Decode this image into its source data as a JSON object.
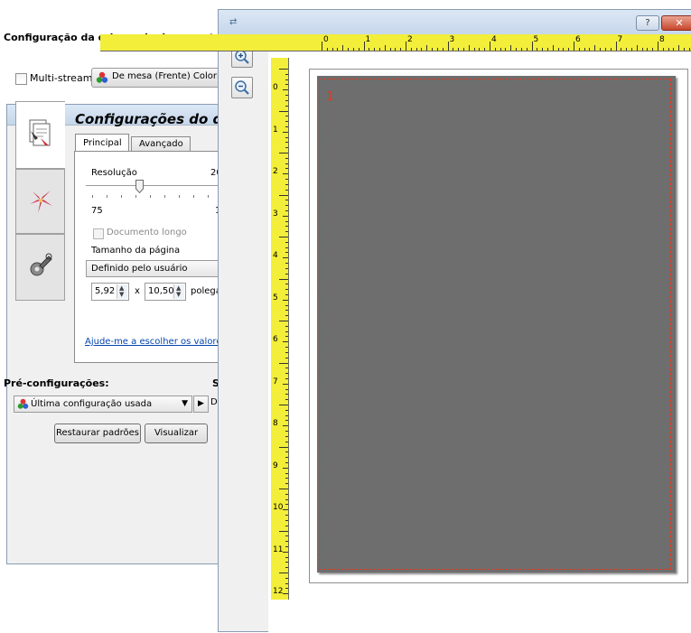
{
  "settings_window": {
    "title": "Configuração da origem do documento",
    "multistream_label": "Multi-stream",
    "multistream_checked": false,
    "source_button_label": "De mesa (Frente) Colori",
    "panel_heading": "Configurações do do",
    "tabs": [
      "Principal",
      "Avançado"
    ],
    "active_tab": "Principal",
    "resolution_label": "Resolução",
    "resolution_value_partial": "200",
    "resolution_min": "75",
    "resolution_max_partial": "1",
    "long_document_label": "Documento longo",
    "long_document_checked": false,
    "page_size_label": "Tamanho da página",
    "page_size_value": "Definido pelo usuário",
    "width_value": "5,92",
    "height_value": "10,50",
    "times_sign": "x",
    "unit_partial": "polega",
    "help_link": "Ajude-me a escolher os valore",
    "presets_label": "Pré-configurações:",
    "s_partial": "S",
    "presets_value": "Última configuração usada",
    "d_partial": "D",
    "restore_button": "Restaurar padrões",
    "preview_button": "Visualizar"
  },
  "preview_window": {
    "help_button": "?",
    "close_button": "✕",
    "region_number": "1",
    "top_ruler_numbers": [
      "0",
      "1",
      "2",
      "3",
      "4",
      "5",
      "6",
      "7",
      "8"
    ],
    "left_ruler_numbers": [
      "0",
      "1",
      "2",
      "3",
      "4",
      "5",
      "6",
      "7",
      "8",
      "9",
      "10",
      "11",
      "12"
    ]
  },
  "colors": {
    "ruler": "#f2ee3a",
    "scan_area": "#6e6e6e",
    "region_border": "#e03a1e",
    "link": "#0645ad"
  }
}
